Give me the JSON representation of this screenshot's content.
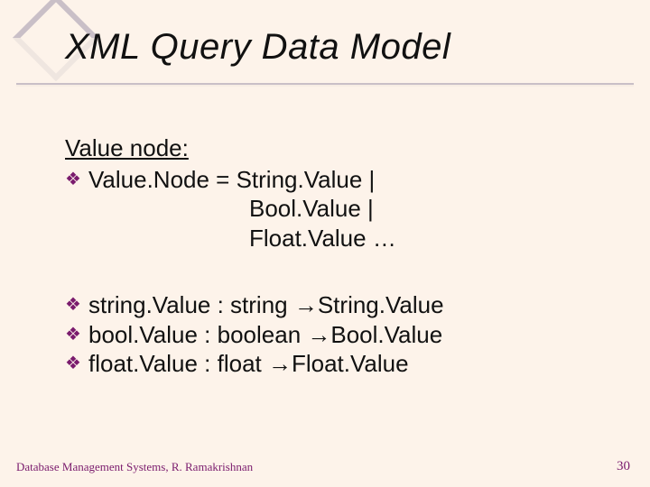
{
  "slide": {
    "title": "XML Query Data Model",
    "heading": "Value node:",
    "b1_line1": "Value.Node = String.Value  |",
    "b1_line2": "Bool.Value  |",
    "b1_line3": "Float.Value   …",
    "b2": "string.Value  : string →String.Value",
    "b3": "bool.Value    : boolean →Bool.Value",
    "b4": "float.Value   : float →Float.Value"
  },
  "footer": {
    "left": "Database Management Systems, R. Ramakrishnan",
    "page": "30"
  }
}
